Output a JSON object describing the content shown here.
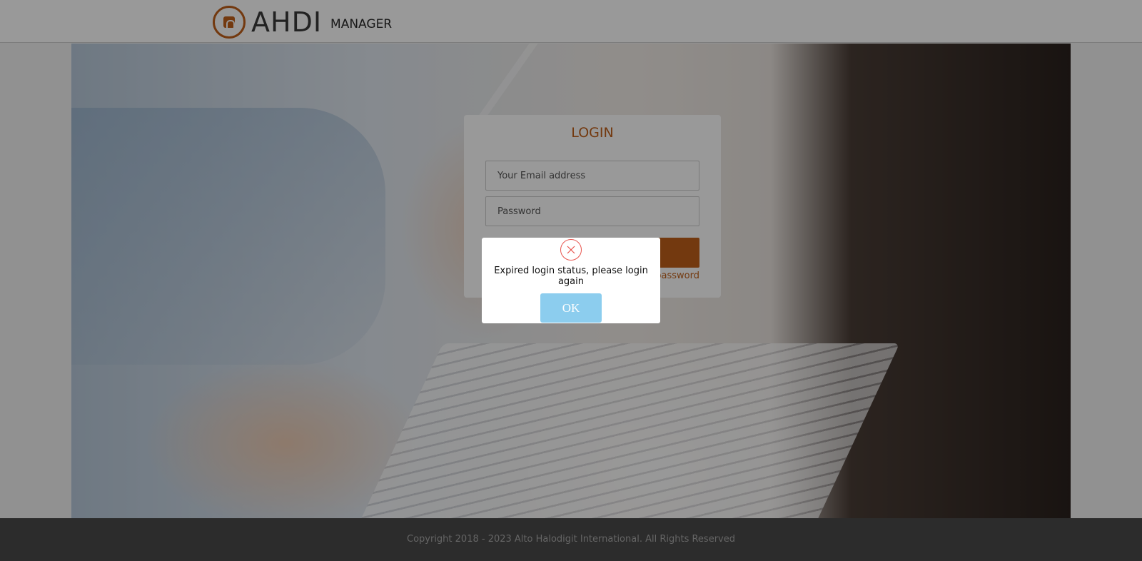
{
  "header": {
    "logo_name": "AHDI",
    "logo_sub": "MANAGER"
  },
  "login": {
    "title": "LOGIN",
    "email_placeholder": "Your Email address",
    "password_placeholder": "Password",
    "forgot_link": "password"
  },
  "modal": {
    "icon": "error-x-icon",
    "message": "Expired login status, please login again",
    "ok_label": "OK"
  },
  "footer": {
    "copyright": "Copyright 2018 - 2023 Alto Halodigit International. All Rights Reserved"
  },
  "colors": {
    "brand": "#c0601a",
    "ok_button": "#8ccdee",
    "error": "#e8544e"
  }
}
